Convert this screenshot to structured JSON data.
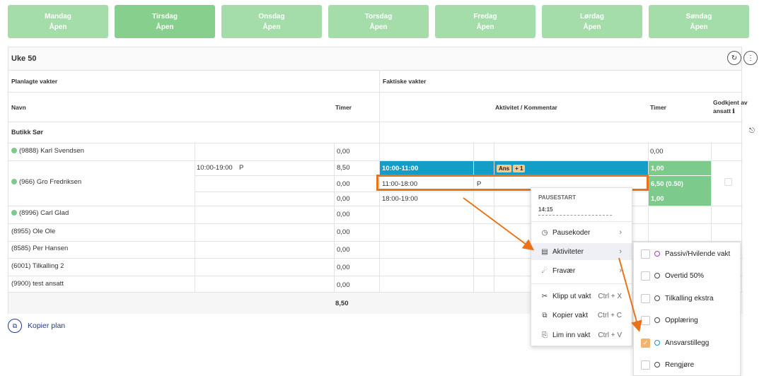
{
  "days": [
    {
      "name": "Mandag",
      "status": "Åpen"
    },
    {
      "name": "Tirsdag",
      "status": "Åpen"
    },
    {
      "name": "Onsdag",
      "status": "Åpen"
    },
    {
      "name": "Torsdag",
      "status": "Åpen"
    },
    {
      "name": "Fredag",
      "status": "Åpen"
    },
    {
      "name": "Lørdag",
      "status": "Åpen"
    },
    {
      "name": "Søndag",
      "status": "Åpen"
    }
  ],
  "week": {
    "title": "Uke 50"
  },
  "headers": {
    "planned": "Planlagte vakter",
    "actual": "Faktiske vakter",
    "name": "Navn",
    "hours": "Timer",
    "activity": "Aktivitet / Kommentar",
    "hours2": "Timer",
    "approved_1": "Godkjent av",
    "approved_2": "ansatt"
  },
  "group": "Butikk Sør",
  "employees": {
    "e1": {
      "name": "(9888) Karl Svendsen",
      "planned_hours": "0,00",
      "actual_hours": "0,00"
    },
    "e2": {
      "name": "(966) Gro Fredriksen",
      "planned_time": "10:00-19:00",
      "planned_code": "P",
      "r1_hours": "8,50",
      "r2_hours": "0,00",
      "r3_hours": "0,00",
      "shift1_time": "10:00-11:00",
      "shift1_tag": "Ans",
      "shift1_tag_extra": "+ 1",
      "shift1_hours": "1,00",
      "shift2_time": "11:00-18:00",
      "shift2_code": "P",
      "shift2_hours": "6,50 (0.50)",
      "shift3_time": "18:00-19:00",
      "shift3_hours": "1,00"
    },
    "e3": {
      "name": "(8996) Carl Glad",
      "planned_hours": "0,00"
    },
    "e4": {
      "name": "(8955) Ole Ole",
      "planned_hours": "0,00"
    },
    "e5": {
      "name": "(8585) Per Hansen",
      "planned_hours": "0,00"
    },
    "e6": {
      "name": "(6001) Tilkalling 2",
      "planned_hours": "0,00"
    },
    "e7": {
      "name": "(9900) test ansatt",
      "planned_hours": "0,00"
    }
  },
  "total": "8,50",
  "context_menu": {
    "pausestart_label": "PAUSESTART",
    "pausestart_value": "14:15",
    "pausekoder": "Pausekoder",
    "aktiviteter": "Aktiviteter",
    "fravaer": "Fravær",
    "klipp": "Klipp ut vakt",
    "klipp_sc": "Ctrl + X",
    "kopier": "Kopier vakt",
    "kopier_sc": "Ctrl + C",
    "lim": "Lim inn vakt",
    "lim_sc": "Ctrl + V"
  },
  "submenu": {
    "i1": "Passiv/Hvilende vakt",
    "i2": "Overtid 50%",
    "i3": "Tilkalling ekstra",
    "i4": "Opplæring",
    "i5": "Ansvarstillegg",
    "i6": "Rengjøre"
  },
  "copy_plan": "Kopier plan",
  "colors": {
    "day_tab": "#a5ddaa",
    "day_tab_active": "#86cf8d",
    "shift_blue": "#139ec9",
    "hours_green": "#7ccb8c",
    "highlight": "#ea7319",
    "tag": "#f6c88c",
    "link": "#1f3b8c"
  }
}
